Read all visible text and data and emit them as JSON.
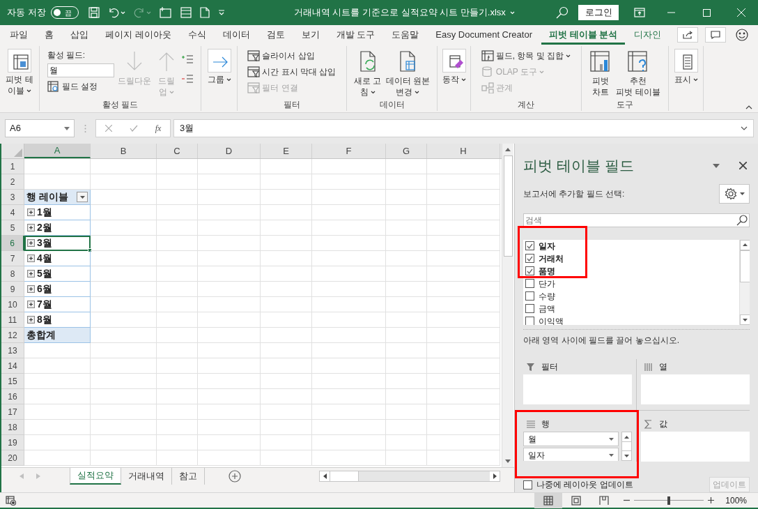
{
  "title_bar": {
    "autosave": {
      "label": "자동 저장",
      "on": false,
      "state": "끔"
    },
    "title": "거래내역 시트를 기준으로 실적요약 시트 만들기.xlsx",
    "login": "로그인"
  },
  "menu_tabs": [
    {
      "label": "파일",
      "selected": false,
      "contextual": false
    },
    {
      "label": "홈",
      "selected": false,
      "contextual": false
    },
    {
      "label": "삽입",
      "selected": false,
      "contextual": false
    },
    {
      "label": "페이지 레이아웃",
      "selected": false,
      "contextual": false
    },
    {
      "label": "수식",
      "selected": false,
      "contextual": false
    },
    {
      "label": "데이터",
      "selected": false,
      "contextual": false
    },
    {
      "label": "검토",
      "selected": false,
      "contextual": false
    },
    {
      "label": "보기",
      "selected": false,
      "contextual": false
    },
    {
      "label": "개발 도구",
      "selected": false,
      "contextual": false
    },
    {
      "label": "도움말",
      "selected": false,
      "contextual": false
    },
    {
      "label": "Easy Document Creator",
      "selected": false,
      "contextual": false
    },
    {
      "label": "피벗 테이블 분석",
      "selected": true,
      "contextual": true
    },
    {
      "label": "디자인",
      "selected": false,
      "contextual": true
    }
  ],
  "ribbon": [
    {
      "items": [
        {
          "kind": "large",
          "lines": [
            "피벗 테",
            "이블"
          ],
          "dropdown": true,
          "disabled": false
        }
      ]
    },
    {
      "label": "활성 필드",
      "items": [
        {
          "kind": "caption",
          "text": "활성 필드:"
        },
        {
          "kind": "field",
          "value": "월"
        },
        {
          "kind": "small",
          "text": "필드 설정",
          "dropdown": false,
          "disabled": false
        },
        {
          "kind": "large",
          "lines": [
            "드릴다운"
          ],
          "dropdown": false,
          "disabled": true
        },
        {
          "kind": "large",
          "lines": [
            "드릴",
            "업"
          ],
          "dropdown": true,
          "disabled": true
        },
        {
          "kind": "icon_stack"
        }
      ]
    },
    {
      "items": [
        {
          "kind": "large",
          "lines": [
            "그룹"
          ],
          "dropdown": true,
          "disabled": false
        }
      ]
    },
    {
      "label": "필터",
      "items": [
        {
          "kind": "small",
          "text": "슬라이서 삽입",
          "dropdown": false,
          "disabled": false
        },
        {
          "kind": "small",
          "text": "시간 표시 막대 삽입",
          "dropdown": false,
          "disabled": false
        },
        {
          "kind": "small",
          "text": "필터 연결",
          "dropdown": false,
          "disabled": true
        }
      ]
    },
    {
      "label": "데이터",
      "items": [
        {
          "kind": "large",
          "lines": [
            "새로 고",
            "침"
          ],
          "dropdown": true,
          "disabled": false
        },
        {
          "kind": "large",
          "lines": [
            "데이터 원본",
            "변경"
          ],
          "dropdown": true,
          "disabled": false
        }
      ]
    },
    {
      "items": [
        {
          "kind": "large",
          "lines": [
            "동작"
          ],
          "dropdown": true,
          "disabled": false
        }
      ]
    },
    {
      "label": "계산",
      "items": [
        {
          "kind": "small",
          "text": "필드, 항목 및 집합",
          "dropdown": true,
          "disabled": false
        },
        {
          "kind": "small",
          "text": "OLAP 도구",
          "dropdown": true,
          "disabled": true
        },
        {
          "kind": "small",
          "text": "관계",
          "dropdown": false,
          "disabled": true
        }
      ]
    },
    {
      "label": "도구",
      "items": [
        {
          "kind": "large",
          "lines": [
            "피벗",
            "차트"
          ],
          "dropdown": false,
          "disabled": false
        },
        {
          "kind": "large",
          "lines": [
            "추천",
            "피벗 테이블"
          ],
          "dropdown": false,
          "disabled": false
        }
      ]
    },
    {
      "items": [
        {
          "kind": "large",
          "lines": [
            "표시"
          ],
          "dropdown": true,
          "disabled": false
        }
      ]
    }
  ],
  "formula_bar": {
    "name_box": "A6",
    "function_button": "fx",
    "formula": "3월"
  },
  "sheet": {
    "columns": [
      {
        "label": "A",
        "selected": true
      },
      {
        "label": "B",
        "selected": false
      },
      {
        "label": "C",
        "selected": false
      },
      {
        "label": "D",
        "selected": false
      },
      {
        "label": "E",
        "selected": false
      },
      {
        "label": "F",
        "selected": false
      },
      {
        "label": "G",
        "selected": false
      },
      {
        "label": "H",
        "selected": false
      }
    ],
    "rows": [
      {
        "number": "1",
        "selected": false
      },
      {
        "number": "2",
        "selected": false
      },
      {
        "number": "3",
        "selected": false
      },
      {
        "number": "4",
        "selected": false
      },
      {
        "number": "5",
        "selected": false
      },
      {
        "number": "6",
        "selected": true
      },
      {
        "number": "7",
        "selected": false
      },
      {
        "number": "8",
        "selected": false
      },
      {
        "number": "9",
        "selected": false
      },
      {
        "number": "10",
        "selected": false
      },
      {
        "number": "11",
        "selected": false
      },
      {
        "number": "12",
        "selected": false
      },
      {
        "number": "13",
        "selected": false
      },
      {
        "number": "14",
        "selected": false
      },
      {
        "number": "15",
        "selected": false
      },
      {
        "number": "16",
        "selected": false
      },
      {
        "number": "17",
        "selected": false
      },
      {
        "number": "18",
        "selected": false
      },
      {
        "number": "19",
        "selected": false
      },
      {
        "number": "20",
        "selected": false
      }
    ],
    "pivot": {
      "header": "행 레이블",
      "items": [
        {
          "label": "1월",
          "selected": false
        },
        {
          "label": "2월",
          "selected": false
        },
        {
          "label": "3월",
          "selected": true
        },
        {
          "label": "4월",
          "selected": false
        },
        {
          "label": "5월",
          "selected": false
        },
        {
          "label": "6월",
          "selected": false
        },
        {
          "label": "7월",
          "selected": false
        },
        {
          "label": "8월",
          "selected": false
        }
      ],
      "total": "총합계"
    }
  },
  "sheet_tabs": [
    {
      "label": "실적요약",
      "selected": true
    },
    {
      "label": "거래내역",
      "selected": false
    },
    {
      "label": "참고",
      "selected": false
    }
  ],
  "pivot_panel": {
    "title": "피벗 테이블 필드",
    "subtitle": "보고서에 추가할 필드 선택:",
    "search": {
      "placeholder": "검색"
    },
    "fields_highlighted": true,
    "fields": [
      {
        "label": "일자",
        "checked": true
      },
      {
        "label": "거래처",
        "checked": true
      },
      {
        "label": "품명",
        "checked": true
      },
      {
        "label": "단가",
        "checked": false
      },
      {
        "label": "수량",
        "checked": false
      },
      {
        "label": "금액",
        "checked": false
      },
      {
        "label": "이익액",
        "checked": false
      }
    ],
    "hint": "아래 영역 사이에 필드를 끌어 놓으십시오.",
    "areas": [
      {
        "kind": "filter",
        "label": "필터",
        "highlighted": false
      },
      {
        "kind": "columns",
        "label": "열",
        "highlighted": false
      },
      {
        "kind": "rows",
        "label": "행",
        "highlighted": true,
        "items": [
          "월",
          "일자"
        ]
      },
      {
        "kind": "values",
        "label": "값",
        "highlighted": false
      }
    ],
    "defer_update": {
      "label": "나중에 레이아웃 업데이트",
      "checked": false
    },
    "update_button": {
      "label": "업데이트",
      "disabled": true
    }
  },
  "status_bar": {
    "views": [
      {
        "selected": true
      },
      {
        "selected": false
      },
      {
        "selected": false
      }
    ],
    "zoom": {
      "level": 0.5,
      "reading": "100%"
    }
  }
}
